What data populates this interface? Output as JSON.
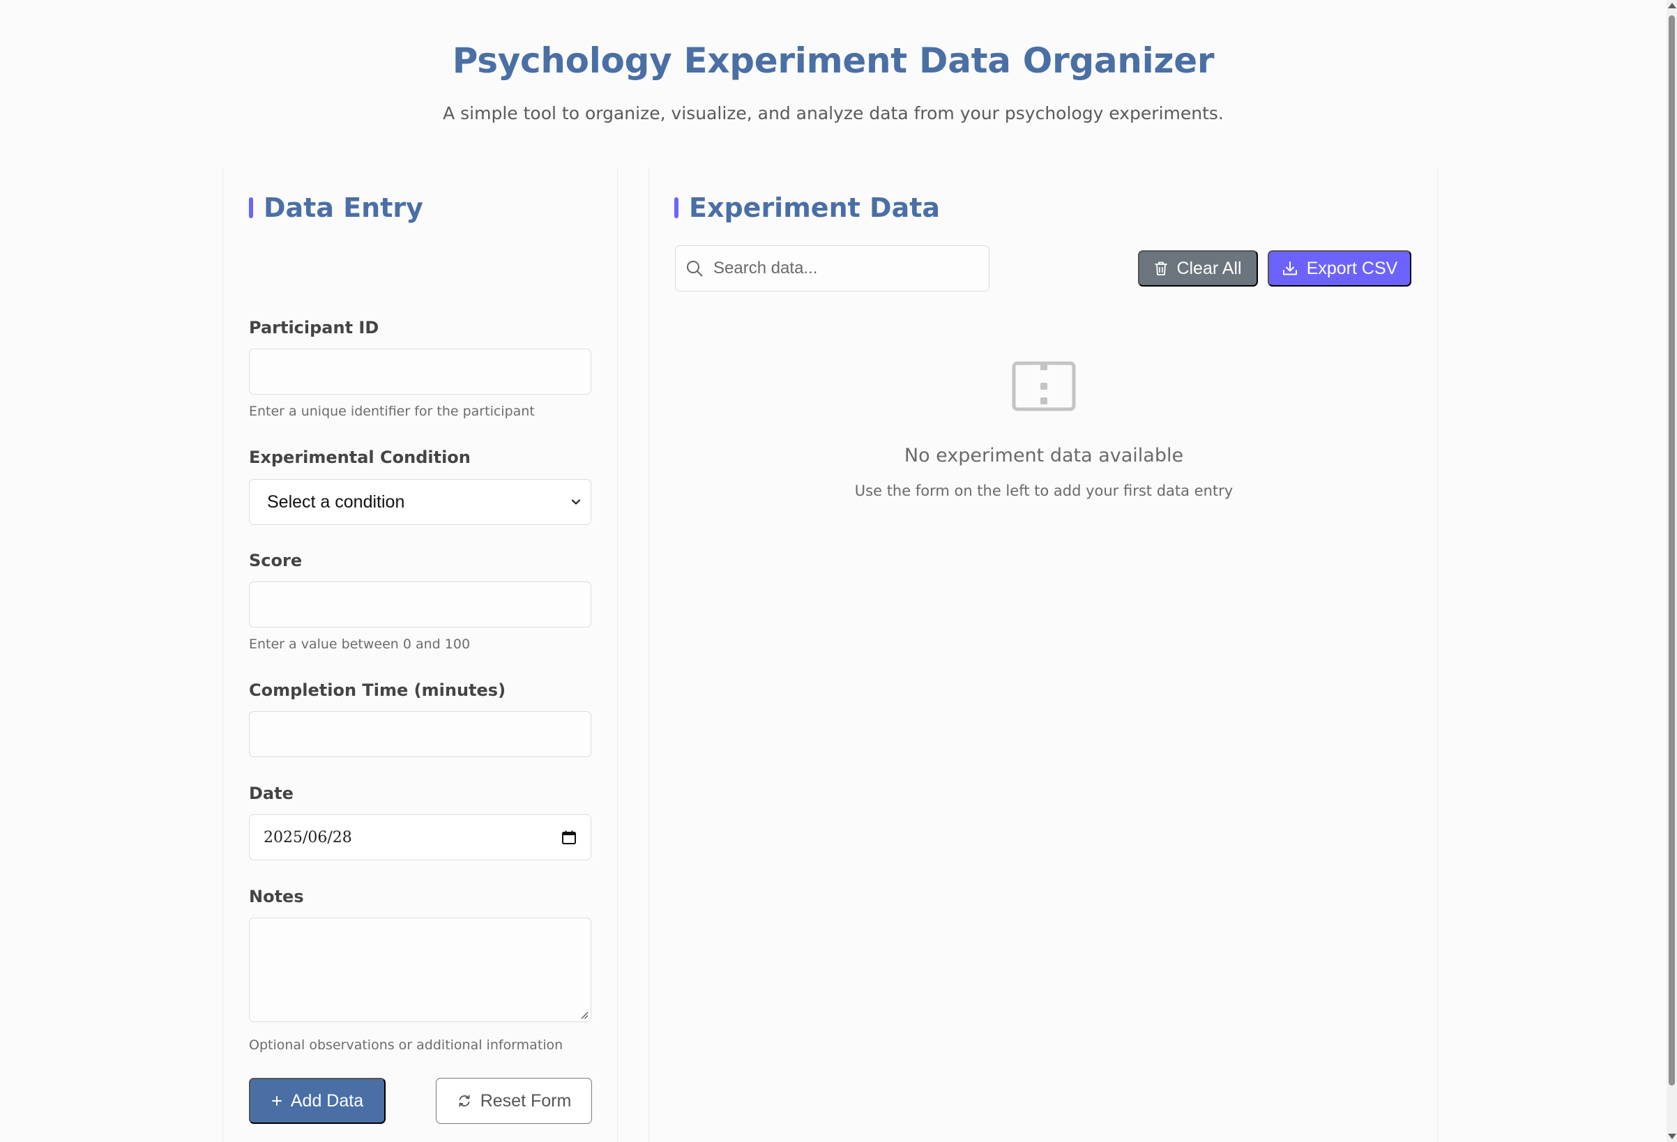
{
  "header": {
    "title": "Psychology Experiment Data Organizer",
    "subtitle": "A simple tool to organize, visualize, and analyze data from your psychology experiments."
  },
  "entry_panel": {
    "heading": "Data Entry",
    "participant_id": {
      "label": "Participant ID",
      "value": "",
      "hint": "Enter a unique identifier for the participant"
    },
    "condition": {
      "label": "Experimental Condition",
      "selected": "Select a condition"
    },
    "score": {
      "label": "Score",
      "value": "",
      "hint": "Enter a value between 0 and 100"
    },
    "completion_time": {
      "label": "Completion Time (minutes)",
      "value": ""
    },
    "date": {
      "label": "Date",
      "value": "2025/06/28"
    },
    "notes": {
      "label": "Notes",
      "value": "",
      "hint": "Optional observations or additional information"
    },
    "add_label": "Add Data",
    "reset_label": "Reset Form"
  },
  "data_panel": {
    "heading": "Experiment Data",
    "search_placeholder": "Search data...",
    "clear_label": "Clear All",
    "export_label": "Export CSV",
    "empty_title": "No experiment data available",
    "empty_text": "Use the form on the left to add your first data entry"
  },
  "icons": {
    "plus": "plus-icon",
    "reset": "refresh-icon",
    "search": "search-icon",
    "clear": "trash-icon",
    "export": "download-icon",
    "empty": "empty-table-icon",
    "calendar": "calendar-icon"
  },
  "colors": {
    "accent": "#6c63ff",
    "primary": "#4a6fa5",
    "secondary": "#6c757d"
  }
}
